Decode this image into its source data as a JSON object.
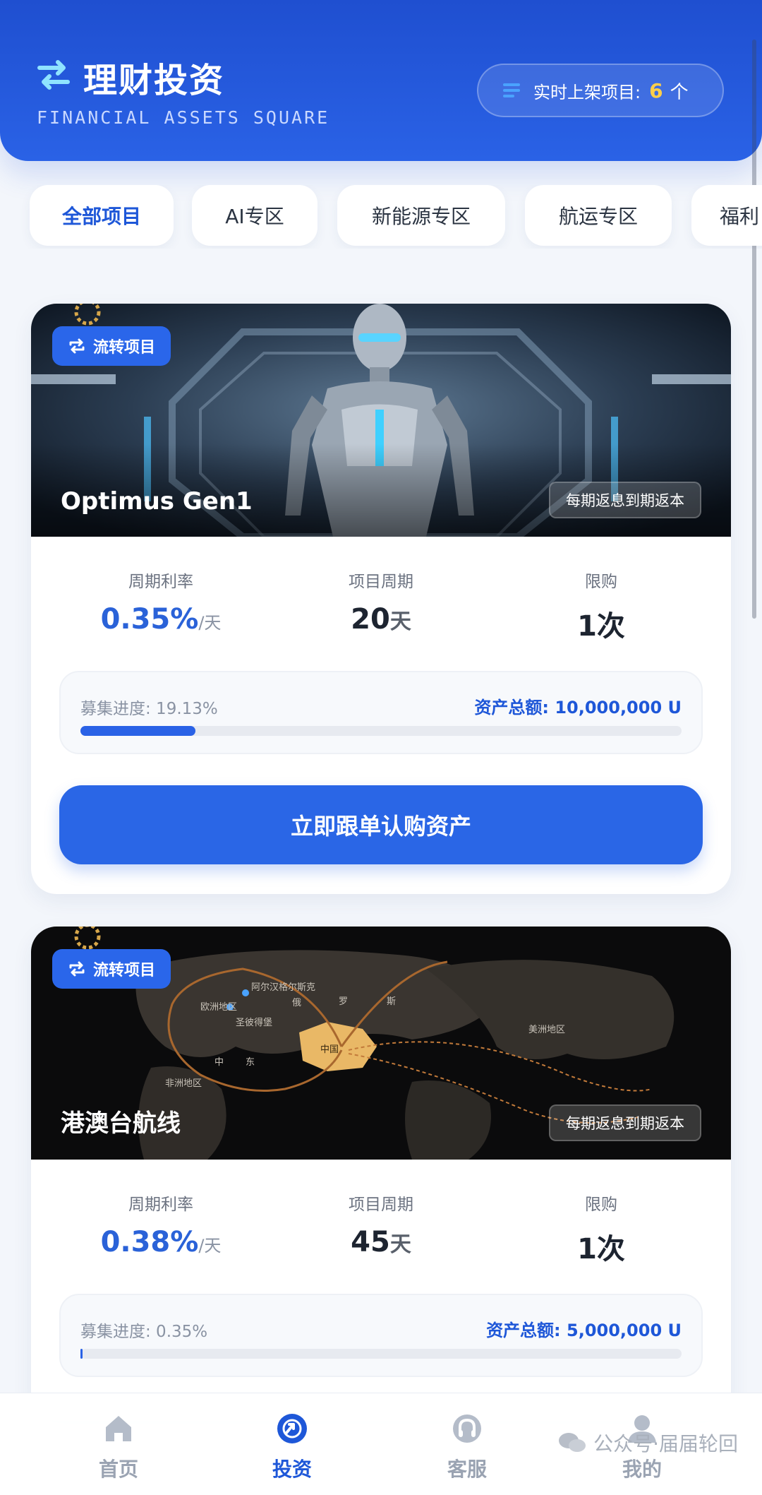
{
  "header": {
    "title": "理财投资",
    "subtitle": "FINANCIAL ASSETS SQUARE",
    "live_label": "实时上架项目:",
    "live_count": "6",
    "live_unit": "个"
  },
  "tabs": [
    {
      "label": "全部项目",
      "active": true
    },
    {
      "label": "AI专区",
      "active": false
    },
    {
      "label": "新能源专区",
      "active": false
    },
    {
      "label": "航运专区",
      "active": false
    },
    {
      "label": "福利",
      "active": false
    }
  ],
  "projects": [
    {
      "badge": "流转项目",
      "name": "Optimus Gen1",
      "return_type": "每期返息到期返本",
      "rate_label": "周期利率",
      "rate": "0.35%",
      "rate_unit": "/天",
      "period_label": "项目周期",
      "period": "20",
      "period_unit": "天",
      "limit_label": "限购",
      "limit": "1次",
      "progress_text": "募集进度: 19.13%",
      "progress_value": 19.13,
      "total_text": "资产总额: 10,000,000 U",
      "cta": "立即跟单认购资产"
    },
    {
      "badge": "流转项目",
      "name": "港澳台航线",
      "return_type": "每期返息到期返本",
      "rate_label": "周期利率",
      "rate": "0.38%",
      "rate_unit": "/天",
      "period_label": "项目周期",
      "period": "45",
      "period_unit": "天",
      "limit_label": "限购",
      "limit": "1次",
      "progress_text": "募集进度: 0.35%",
      "progress_value": 0.35,
      "total_text": "资产总额: 5,000,000 U",
      "map_labels": [
        "阿尔汉格尔斯克",
        "欧洲地区",
        "圣彼得堡",
        "俄",
        "罗",
        "斯",
        "中",
        "东",
        "中国",
        "非洲地区",
        "美洲地区"
      ]
    }
  ],
  "nav": [
    {
      "label": "首页",
      "icon": "home-icon",
      "active": false
    },
    {
      "label": "投资",
      "icon": "invest-icon",
      "active": true
    },
    {
      "label": "客服",
      "icon": "support-icon",
      "active": false
    },
    {
      "label": "我的",
      "icon": "user-icon",
      "active": false
    }
  ],
  "watermark": "公众号·届届轮回",
  "colors": {
    "primary": "#2a66e6",
    "accent": "#ffcf4a"
  }
}
